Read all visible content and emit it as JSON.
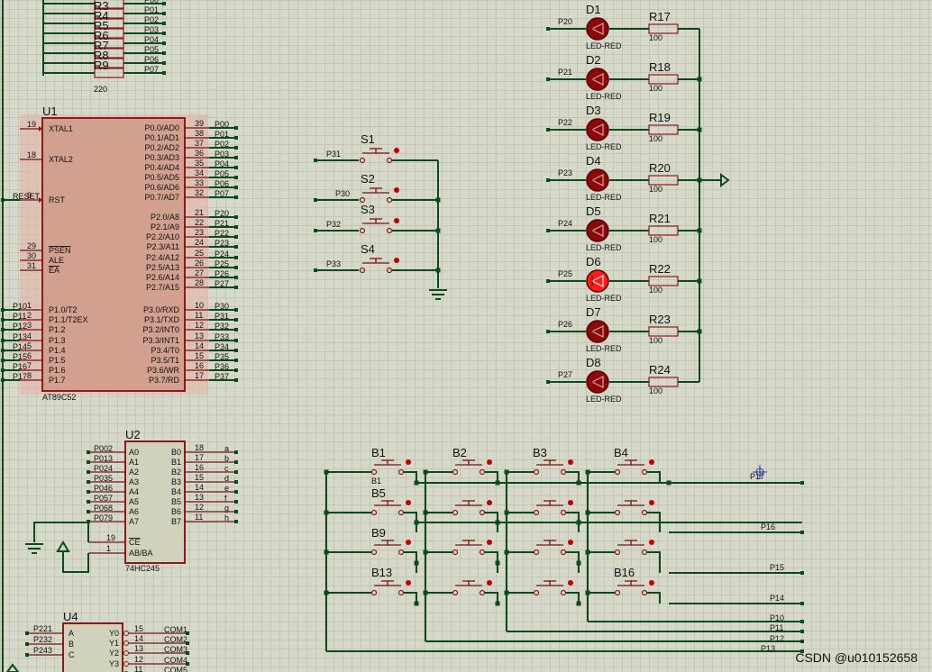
{
  "watermark": "CSDN @u010152658",
  "resistor_pack": {
    "refs": [
      "R3",
      "R4",
      "R5",
      "R6",
      "R7",
      "R8",
      "R9"
    ],
    "nets": [
      "P00",
      "P01",
      "P02",
      "P03",
      "P04",
      "P05",
      "P06",
      "P07"
    ],
    "value": "220"
  },
  "u1": {
    "ref": "U1",
    "part": "AT89C52",
    "left_pins": [
      {
        "num": "19",
        "name": "XTAL1",
        "net": ""
      },
      {
        "num": "18",
        "name": "XTAL2",
        "net": ""
      },
      {
        "num": "9",
        "name": "RST",
        "net": "RESET"
      },
      {
        "num": "29",
        "name": "PSEN",
        "net": ""
      },
      {
        "num": "30",
        "name": "ALE",
        "net": ""
      },
      {
        "num": "31",
        "name": "EA",
        "net": ""
      },
      {
        "num": "1",
        "name": "P1.0/T2",
        "net": "P10"
      },
      {
        "num": "2",
        "name": "P1.1/T2EX",
        "net": "P11"
      },
      {
        "num": "3",
        "name": "P1.2",
        "net": "P12"
      },
      {
        "num": "4",
        "name": "P1.3",
        "net": "P13"
      },
      {
        "num": "5",
        "name": "P1.4",
        "net": "P14"
      },
      {
        "num": "6",
        "name": "P1.5",
        "net": "P15"
      },
      {
        "num": "7",
        "name": "P1.6",
        "net": "P16"
      },
      {
        "num": "8",
        "name": "P1.7",
        "net": "P17"
      }
    ],
    "right_pins": [
      {
        "num": "39",
        "name": "P0.0/AD0",
        "net": "P00"
      },
      {
        "num": "38",
        "name": "P0.1/AD1",
        "net": "P01"
      },
      {
        "num": "37",
        "name": "P0.2/AD2",
        "net": "P02"
      },
      {
        "num": "36",
        "name": "P0.3/AD3",
        "net": "P03"
      },
      {
        "num": "35",
        "name": "P0.4/AD4",
        "net": "P04"
      },
      {
        "num": "34",
        "name": "P0.5/AD5",
        "net": "P05"
      },
      {
        "num": "33",
        "name": "P0.6/AD6",
        "net": "P06"
      },
      {
        "num": "32",
        "name": "P0.7/AD7",
        "net": "P07"
      },
      {
        "num": "21",
        "name": "P2.0/A8",
        "net": "P20"
      },
      {
        "num": "22",
        "name": "P2.1/A9",
        "net": "P21"
      },
      {
        "num": "23",
        "name": "P2.2/A10",
        "net": "P22"
      },
      {
        "num": "24",
        "name": "P2.3/A11",
        "net": "P23"
      },
      {
        "num": "25",
        "name": "P2.4/A12",
        "net": "P24"
      },
      {
        "num": "26",
        "name": "P2.5/A13",
        "net": "P25"
      },
      {
        "num": "27",
        "name": "P2.6/A14",
        "net": "P26"
      },
      {
        "num": "28",
        "name": "P2.7/A15",
        "net": "P27"
      },
      {
        "num": "10",
        "name": "P3.0/RXD",
        "net": "P30"
      },
      {
        "num": "11",
        "name": "P3.1/TXD",
        "net": "P31"
      },
      {
        "num": "12",
        "name": "P3.2/INT0",
        "net": "P32"
      },
      {
        "num": "13",
        "name": "P3.3/INT1",
        "net": "P33"
      },
      {
        "num": "14",
        "name": "P3.4/T0",
        "net": "P34"
      },
      {
        "num": "15",
        "name": "P3.5/T1",
        "net": "P35"
      },
      {
        "num": "16",
        "name": "P3.6/WR",
        "net": "P36"
      },
      {
        "num": "17",
        "name": "P3.7/RD",
        "net": "P37"
      }
    ]
  },
  "switches": [
    {
      "ref": "S1",
      "net": "P31"
    },
    {
      "ref": "S2",
      "net": "P30"
    },
    {
      "ref": "S3",
      "net": "P32"
    },
    {
      "ref": "S4",
      "net": "P33"
    }
  ],
  "leds": [
    {
      "ref": "D1",
      "net": "P20",
      "resistor": "R17",
      "value": "100",
      "type": "LED-RED",
      "lit": false
    },
    {
      "ref": "D2",
      "net": "P21",
      "resistor": "R18",
      "value": "100",
      "type": "LED-RED",
      "lit": false
    },
    {
      "ref": "D3",
      "net": "P22",
      "resistor": "R19",
      "value": "100",
      "type": "LED-RED",
      "lit": false
    },
    {
      "ref": "D4",
      "net": "P23",
      "resistor": "R20",
      "value": "100",
      "type": "LED-RED",
      "lit": false
    },
    {
      "ref": "D5",
      "net": "P24",
      "resistor": "R21",
      "value": "100",
      "type": "LED-RED",
      "lit": false
    },
    {
      "ref": "D6",
      "net": "P25",
      "resistor": "R22",
      "value": "100",
      "type": "LED-RED",
      "lit": true
    },
    {
      "ref": "D7",
      "net": "P26",
      "resistor": "R23",
      "value": "100",
      "type": "LED-RED",
      "lit": false
    },
    {
      "ref": "D8",
      "net": "P27",
      "resistor": "R24",
      "value": "100",
      "type": "LED-RED",
      "lit": false
    }
  ],
  "u2": {
    "ref": "U2",
    "part": "74HC245",
    "a_pins": [
      {
        "num": "2",
        "name": "A0",
        "net": "P00"
      },
      {
        "num": "3",
        "name": "A1",
        "net": "P01"
      },
      {
        "num": "4",
        "name": "A2",
        "net": "P02"
      },
      {
        "num": "5",
        "name": "A3",
        "net": "P03"
      },
      {
        "num": "6",
        "name": "A4",
        "net": "P04"
      },
      {
        "num": "7",
        "name": "A5",
        "net": "P05"
      },
      {
        "num": "8",
        "name": "A6",
        "net": "P06"
      },
      {
        "num": "9",
        "name": "A7",
        "net": "P07"
      }
    ],
    "b_pins": [
      {
        "num": "18",
        "name": "B0",
        "net": "a"
      },
      {
        "num": "17",
        "name": "B1",
        "net": "b"
      },
      {
        "num": "16",
        "name": "B2",
        "net": "c"
      },
      {
        "num": "15",
        "name": "B3",
        "net": "d"
      },
      {
        "num": "14",
        "name": "B4",
        "net": "e"
      },
      {
        "num": "13",
        "name": "B5",
        "net": "f"
      },
      {
        "num": "12",
        "name": "B6",
        "net": "g"
      },
      {
        "num": "11",
        "name": "B7",
        "net": "h"
      }
    ],
    "ctrl_pins": [
      {
        "num": "19",
        "name": "CE"
      },
      {
        "num": "1",
        "name": "AB/BA"
      }
    ]
  },
  "u4": {
    "ref": "U4",
    "inputs": [
      {
        "name": "A",
        "net": "P22"
      },
      {
        "name": "B",
        "net": "P23"
      },
      {
        "name": "C",
        "net": "P24"
      }
    ],
    "outputs": [
      {
        "name": "Y0",
        "num": "15",
        "net": "COM1"
      },
      {
        "name": "Y1",
        "num": "14",
        "net": "COM2"
      },
      {
        "name": "Y2",
        "num": "13",
        "net": "COM3"
      },
      {
        "name": "Y3",
        "num": "12",
        "net": "COM4"
      },
      {
        "name": "",
        "num": "11",
        "net": "COM5"
      }
    ]
  },
  "keypad": {
    "labels": [
      "B1",
      "B2",
      "B3",
      "B4",
      "B5",
      "B9",
      "B13",
      "B16"
    ],
    "sub_label": "B1",
    "row_nets": [
      "P17",
      "P16",
      "P15",
      "P14"
    ],
    "col_nets": [
      "P10",
      "P11",
      "P12",
      "P13"
    ]
  }
}
